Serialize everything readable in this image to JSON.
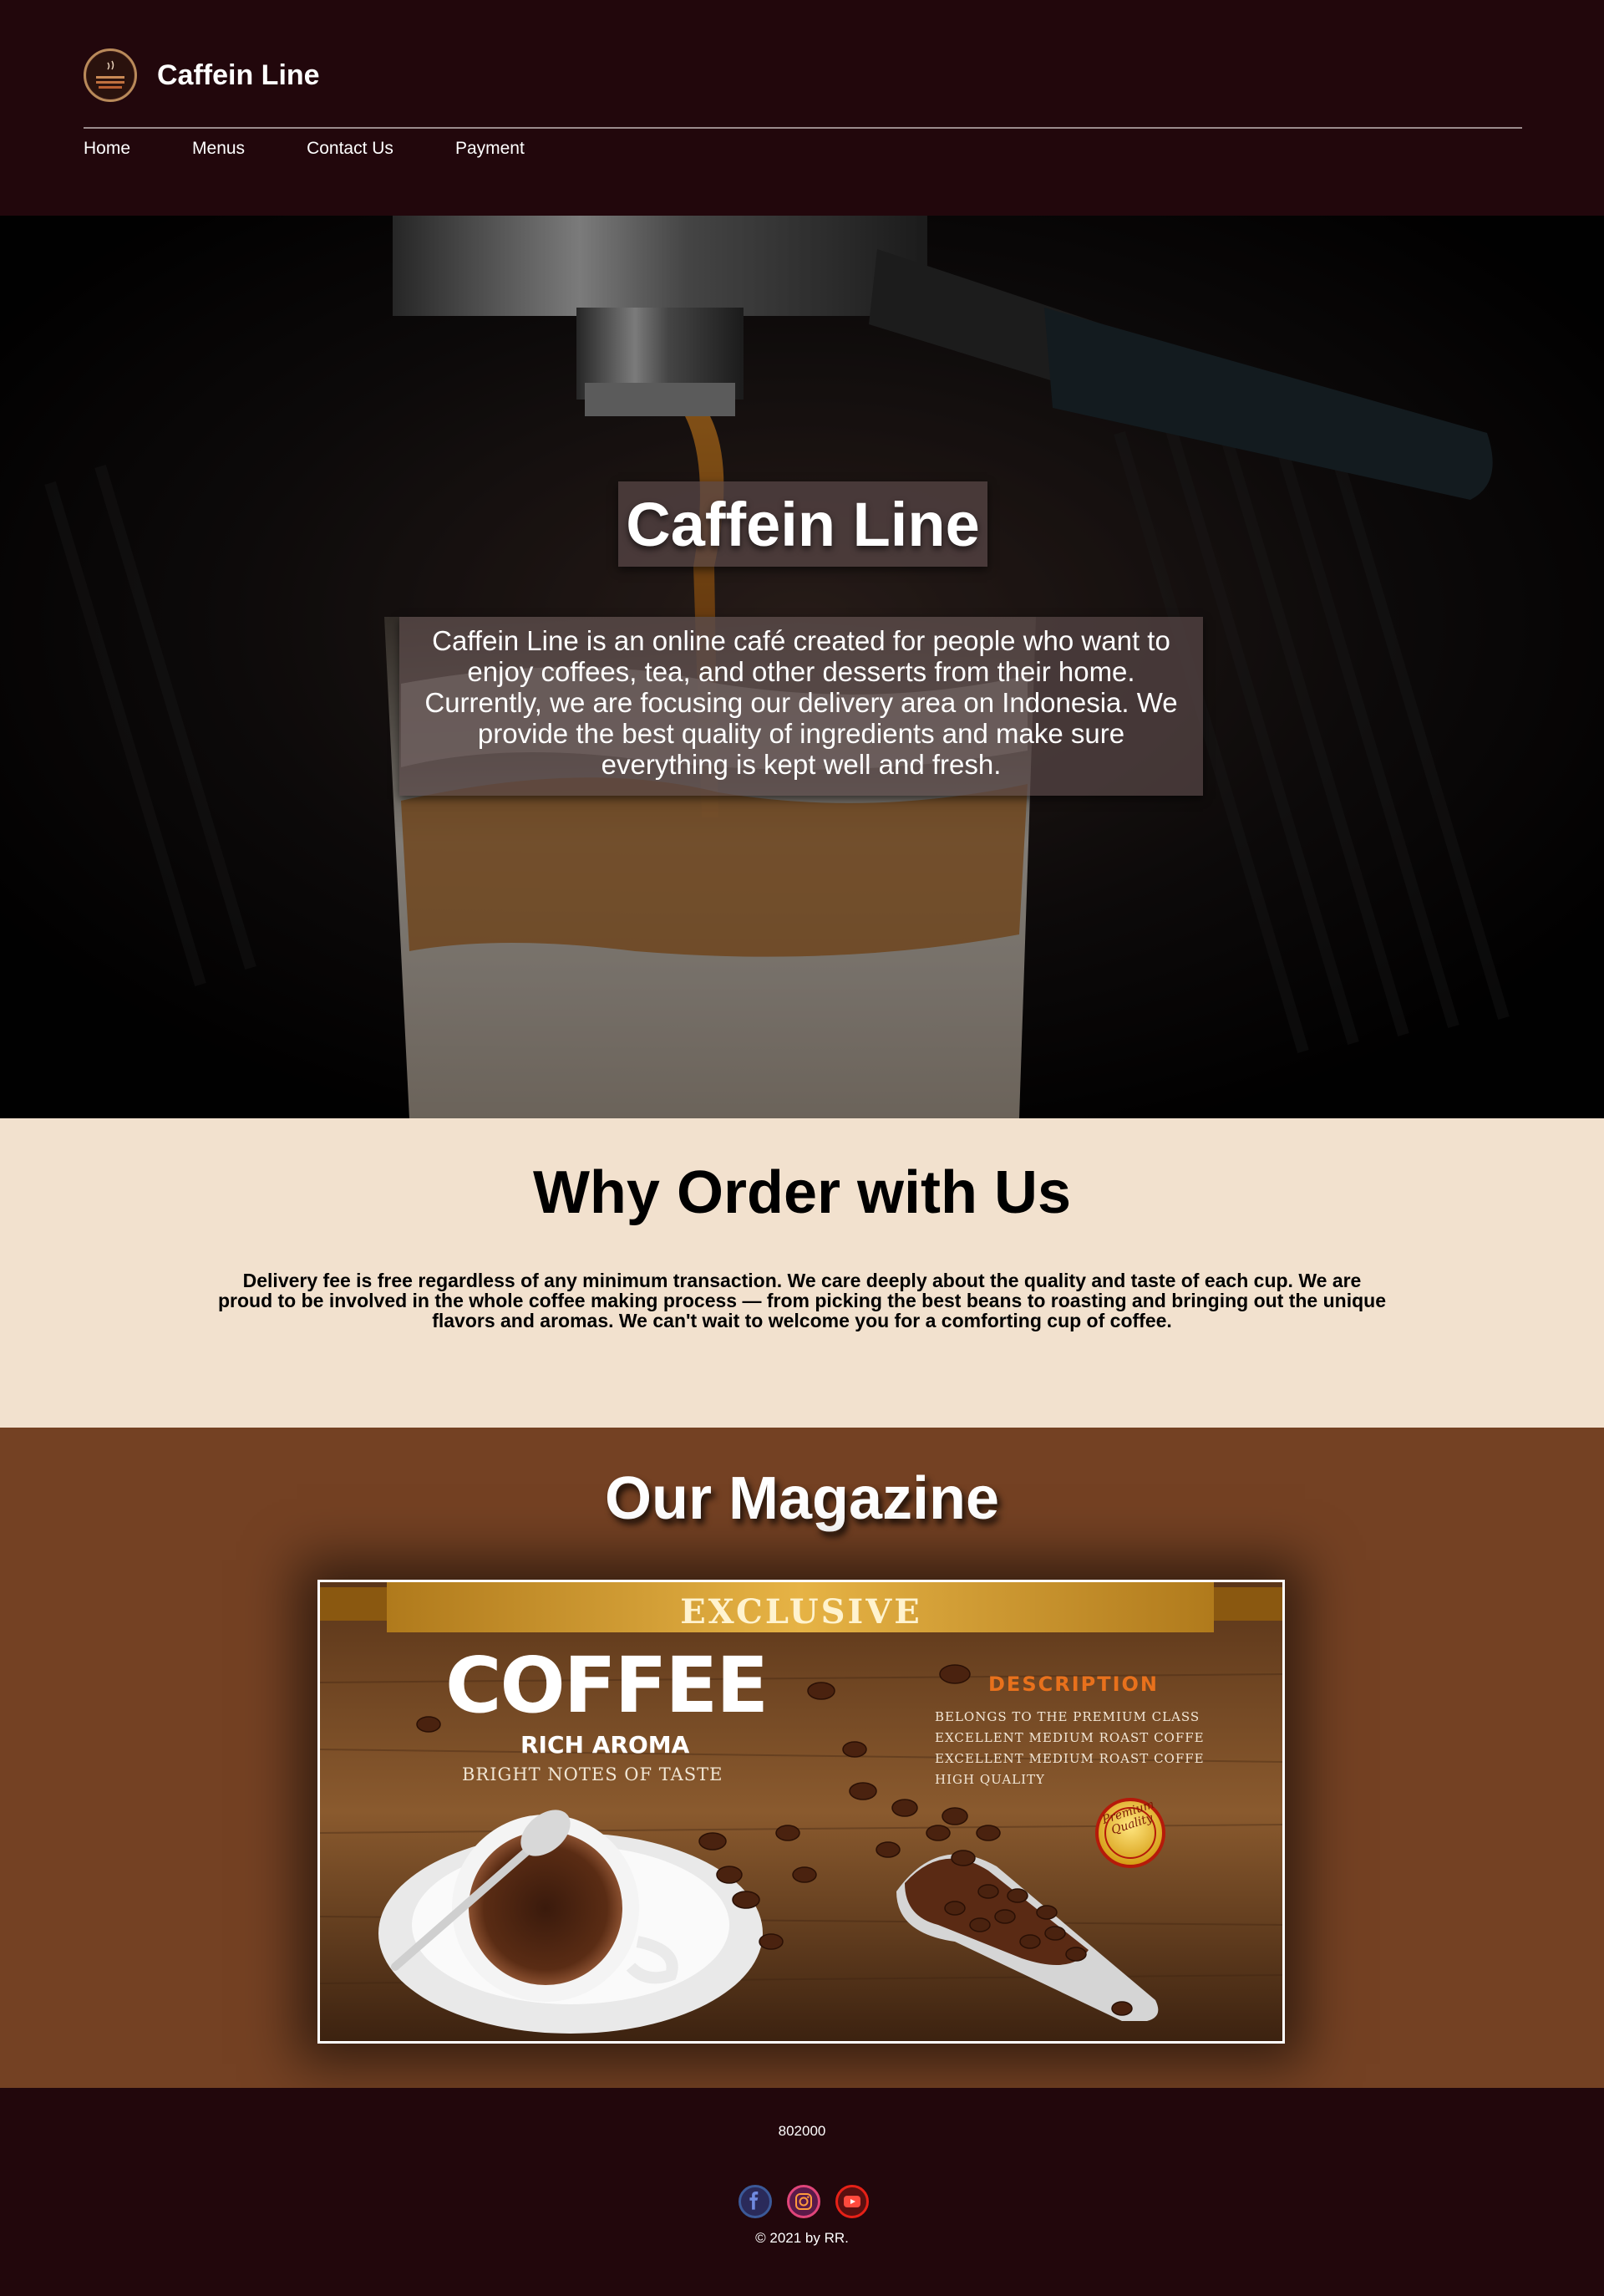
{
  "header": {
    "brand_name": "Caffein Line",
    "nav": [
      {
        "label": "Home"
      },
      {
        "label": "Menus"
      },
      {
        "label": "Contact Us"
      },
      {
        "label": "Payment"
      }
    ]
  },
  "hero": {
    "title": "Caffein Line",
    "description": "Caffein Line is an online café created for people who want to enjoy coffees, tea, and other desserts from their home. Currently, we are focusing our delivery area on Indonesia. We provide the best quality of ingredients and make sure everything is kept well and fresh."
  },
  "why": {
    "title": "Why Order with Us",
    "text": "Delivery fee is free regardless of any minimum transaction. We care deeply about the quality and taste of each cup. We are proud to be involved in the whole coffee making process — from picking the best beans to roasting and bringing out the unique flavors and aromas. We can't wait to welcome you for a comforting cup of coffee."
  },
  "magazine": {
    "title": "Our Magazine",
    "poster": {
      "banner": "EXCLUSIVE",
      "headline": "COFFEE",
      "subheadline": "RICH AROMA",
      "tagline": "BRIGHT NOTES OF TASTE",
      "description_title": "DESCRIPTION",
      "description_lines": [
        "BELONGS TO THE PREMIUM CLASS",
        "EXCELLENT  MEDIUM ROAST COFFE",
        "EXCELLENT  MEDIUM ROAST COFFE",
        "HIGH QUALITY"
      ],
      "badge": "Premium Quality"
    }
  },
  "footer": {
    "code": "802000",
    "copyright": "© 2021 by RR.",
    "socials": [
      {
        "name": "facebook-icon",
        "color": "#3b5998"
      },
      {
        "name": "instagram-icon",
        "color": "#c13584"
      },
      {
        "name": "youtube-icon",
        "color": "#e62117"
      }
    ]
  },
  "colors": {
    "header_bg": "#22070c",
    "why_bg": "#f2e1ce",
    "magazine_bg": "#744123",
    "accent_orange": "#e8711c"
  }
}
